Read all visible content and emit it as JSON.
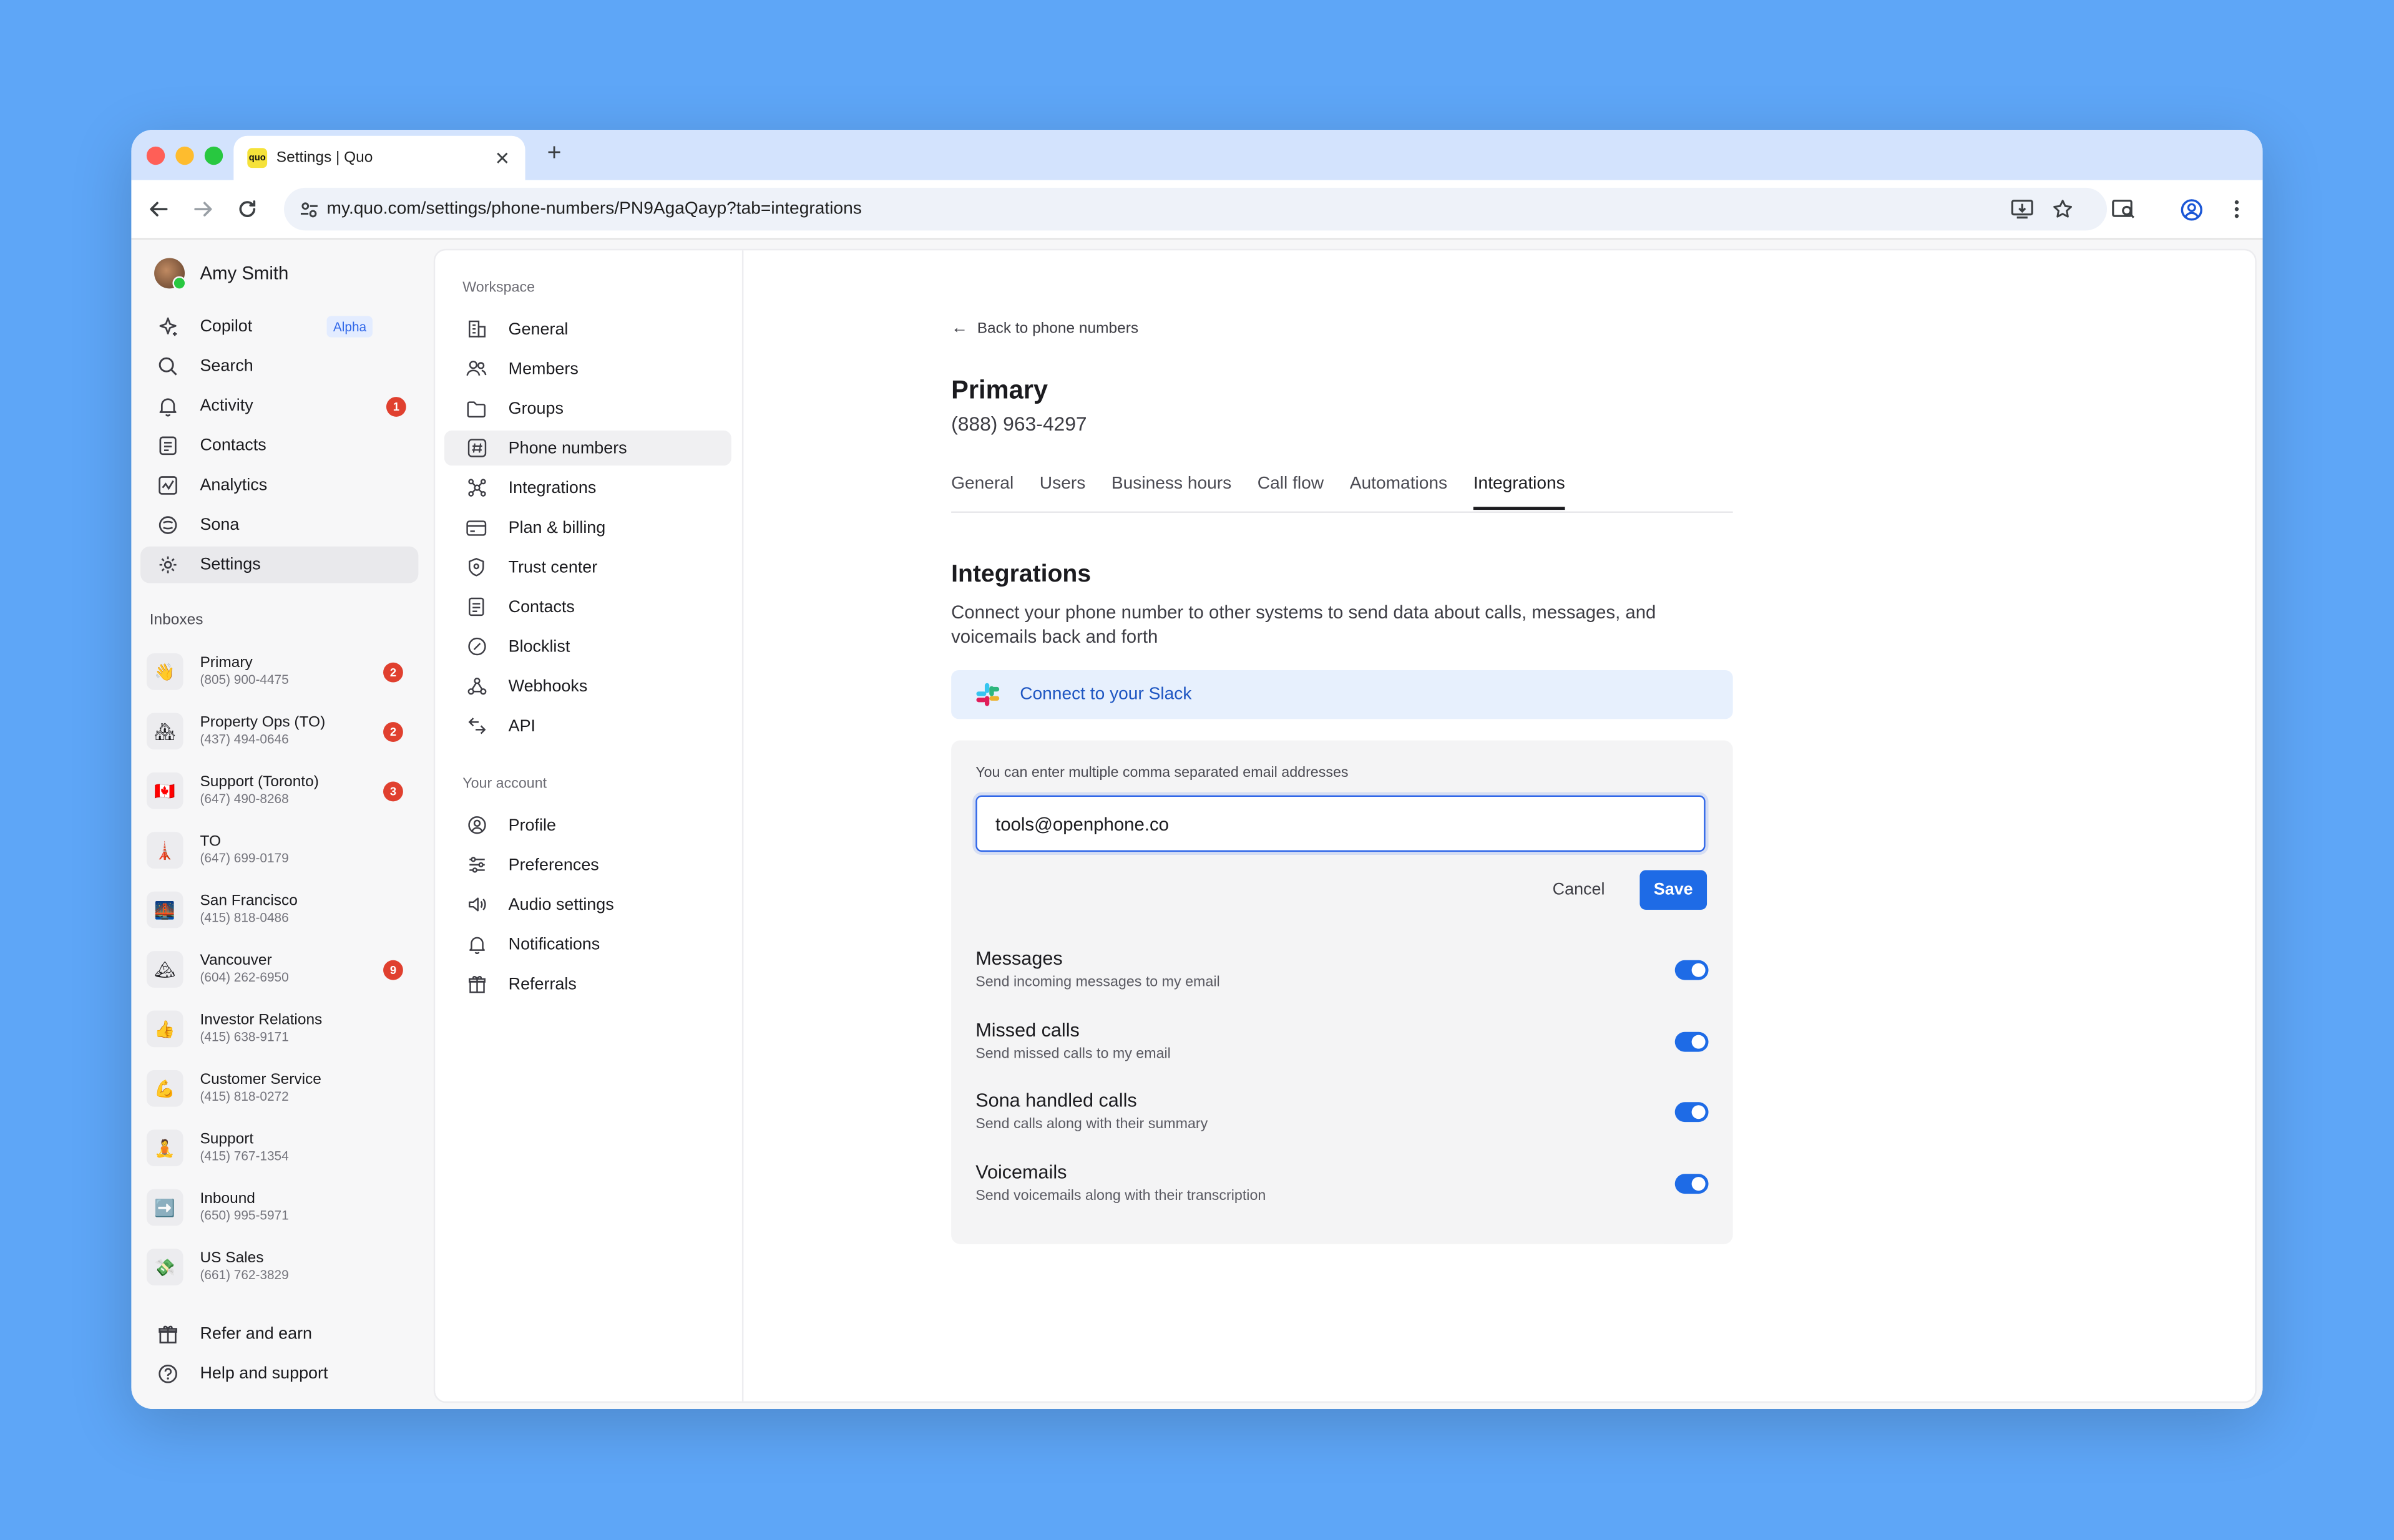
{
  "browser": {
    "tab_title": "Settings | Quo",
    "favicon_text": "quo",
    "url": "my.quo.com/settings/phone-numbers/PN9AgaQayp?tab=integrations"
  },
  "sidebar": {
    "user_name": "Amy Smith",
    "nav": [
      {
        "label": "Copilot",
        "tag": "Alpha",
        "icon": "sparkle-icon"
      },
      {
        "label": "Search",
        "icon": "search-icon"
      },
      {
        "label": "Activity",
        "badge": "1",
        "icon": "bell-icon"
      },
      {
        "label": "Contacts",
        "icon": "contacts-icon"
      },
      {
        "label": "Analytics",
        "icon": "analytics-icon"
      },
      {
        "label": "Sona",
        "icon": "sona-icon"
      },
      {
        "label": "Settings",
        "icon": "gear-icon"
      }
    ],
    "inboxes_label": "Inboxes",
    "inboxes": [
      {
        "name": "Primary",
        "phone": "(805) 900-4475",
        "badge": "2",
        "emoji": "👋"
      },
      {
        "name": "Property Ops (TO)",
        "phone": "(437) 494-0646",
        "badge": "2",
        "emoji": "🏘"
      },
      {
        "name": "Support (Toronto)",
        "phone": "(647) 490-8268",
        "badge": "3",
        "emoji": "🇨🇦"
      },
      {
        "name": "TO",
        "phone": "(647) 699-0179",
        "emoji": "🗼"
      },
      {
        "name": "San Francisco",
        "phone": "(415) 818-0486",
        "emoji": "🌉"
      },
      {
        "name": "Vancouver",
        "phone": "(604) 262-6950",
        "badge": "9",
        "emoji": "🏔"
      },
      {
        "name": "Investor Relations",
        "phone": "(415) 638-9171",
        "emoji": "👍"
      },
      {
        "name": "Customer Service",
        "phone": "(415) 818-0272",
        "emoji": "💪"
      },
      {
        "name": "Support",
        "phone": "(415) 767-1354",
        "emoji": "🧘"
      },
      {
        "name": "Inbound",
        "phone": "(650) 995-5971",
        "emoji": "➡️"
      },
      {
        "name": "US Sales",
        "phone": "(661) 762-3829",
        "emoji": "💸"
      }
    ],
    "footer": [
      {
        "label": "Refer and earn",
        "icon": "gift-icon"
      },
      {
        "label": "Help and support",
        "icon": "help-icon"
      }
    ]
  },
  "settings_nav": {
    "workspace_label": "Workspace",
    "workspace": [
      {
        "label": "General",
        "icon": "building-icon"
      },
      {
        "label": "Members",
        "icon": "members-icon"
      },
      {
        "label": "Groups",
        "icon": "folder-icon"
      },
      {
        "label": "Phone numbers",
        "icon": "hash-icon"
      },
      {
        "label": "Integrations",
        "icon": "integrations-icon"
      },
      {
        "label": "Plan & billing",
        "icon": "card-icon"
      },
      {
        "label": "Trust center",
        "icon": "shield-icon"
      },
      {
        "label": "Contacts",
        "icon": "contacts-icon"
      },
      {
        "label": "Blocklist",
        "icon": "block-icon"
      },
      {
        "label": "Webhooks",
        "icon": "webhook-icon"
      },
      {
        "label": "API",
        "icon": "api-icon"
      }
    ],
    "account_label": "Your account",
    "account": [
      {
        "label": "Profile",
        "icon": "profile-icon"
      },
      {
        "label": "Preferences",
        "icon": "sliders-icon"
      },
      {
        "label": "Audio settings",
        "icon": "speaker-icon"
      },
      {
        "label": "Notifications",
        "icon": "bell-icon"
      },
      {
        "label": "Referrals",
        "icon": "gift-icon"
      }
    ]
  },
  "main": {
    "back_label": "Back to phone numbers",
    "title": "Primary",
    "phone": "(888) 963-4297",
    "tabs": [
      "General",
      "Users",
      "Business hours",
      "Call flow",
      "Automations",
      "Integrations"
    ],
    "active_tab": "Integrations",
    "section_title": "Integrations",
    "section_desc": "Connect your phone number to other systems to send data about calls, messages, and voicemails back and forth",
    "slack_label": "Connect to your Slack",
    "email_hint": "You can enter multiple comma separated email addresses",
    "email_value": "tools@openphone.co",
    "cancel_label": "Cancel",
    "save_label": "Save",
    "prefs": [
      {
        "title": "Messages",
        "desc": "Send incoming messages to my email",
        "enabled": true
      },
      {
        "title": "Missed calls",
        "desc": "Send missed calls to my email",
        "enabled": true
      },
      {
        "title": "Sona handled calls",
        "desc": "Send calls along with their summary",
        "enabled": true
      },
      {
        "title": "Voicemails",
        "desc": "Send voicemails along with their transcription",
        "enabled": true
      }
    ]
  },
  "colors": {
    "background": "#5ea6f7",
    "accent": "#1e6be6",
    "badge": "#e0402f",
    "slack_bg": "#e7f0fd"
  }
}
